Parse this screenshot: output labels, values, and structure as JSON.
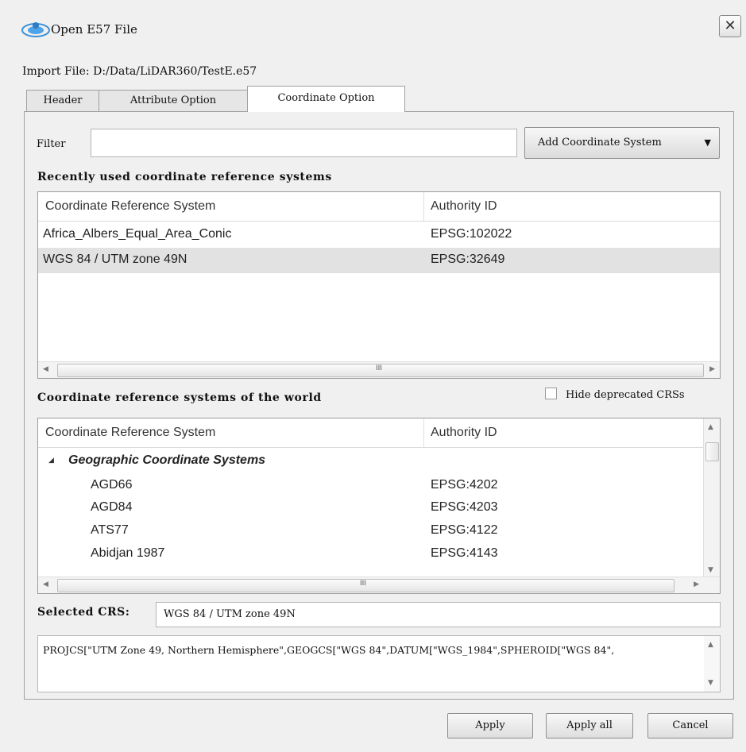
{
  "window": {
    "title": "Open E57 File",
    "close_glyph": "✕"
  },
  "import_file": {
    "label": "Import File:",
    "path": "D:/Data/LiDAR360/TestE.e57"
  },
  "tabs": [
    {
      "label": "Header",
      "active": false
    },
    {
      "label": "Attribute Option",
      "active": false
    },
    {
      "label": "Coordinate Option",
      "active": true
    }
  ],
  "filter": {
    "label": "Filter",
    "value": "",
    "placeholder": ""
  },
  "add_button": {
    "label": "Add Coordinate System",
    "icon": "caret-down-icon"
  },
  "recent": {
    "title": "Recently used coordinate reference systems",
    "columns": [
      "Coordinate Reference System",
      "Authority ID"
    ],
    "rows": [
      {
        "crs": "Africa_Albers_Equal_Area_Conic",
        "id": "EPSG:102022",
        "selected": false
      },
      {
        "crs": "WGS 84 / UTM zone 49N",
        "id": "EPSG:32649",
        "selected": true
      }
    ]
  },
  "world": {
    "title": "Coordinate reference systems of the world",
    "hide_deprecated": {
      "label": "Hide deprecated CRSs",
      "checked": false
    },
    "columns": [
      "Coordinate Reference System",
      "Authority ID"
    ],
    "group": "Geographic Coordinate Systems",
    "rows": [
      {
        "crs": "AGD66",
        "id": "EPSG:4202"
      },
      {
        "crs": "AGD84",
        "id": "EPSG:4203"
      },
      {
        "crs": "ATS77",
        "id": "EPSG:4122"
      },
      {
        "crs": "Abidjan 1987",
        "id": "EPSG:4143"
      }
    ]
  },
  "selected_crs": {
    "label": "Selected CRS:",
    "value": "WGS 84 / UTM zone 49N"
  },
  "wkt": {
    "text": "PROJCS[\"UTM Zone 49, Northern Hemisphere\",GEOGCS[\"WGS 84\",DATUM[\"WGS_1984\",SPHEROID[\"WGS 84\","
  },
  "buttons": {
    "apply": "Apply",
    "apply_all": "Apply all",
    "cancel": "Cancel"
  },
  "scrollbar_glyphs": {
    "left": "◀",
    "right": "▶",
    "up": "▲",
    "down": "▼",
    "grip": "III",
    "collapse": "◢"
  },
  "colors": {
    "window_bg": "#f0f0f0",
    "selected_row": "#e2e2e2",
    "border": "#9c9c9c"
  }
}
